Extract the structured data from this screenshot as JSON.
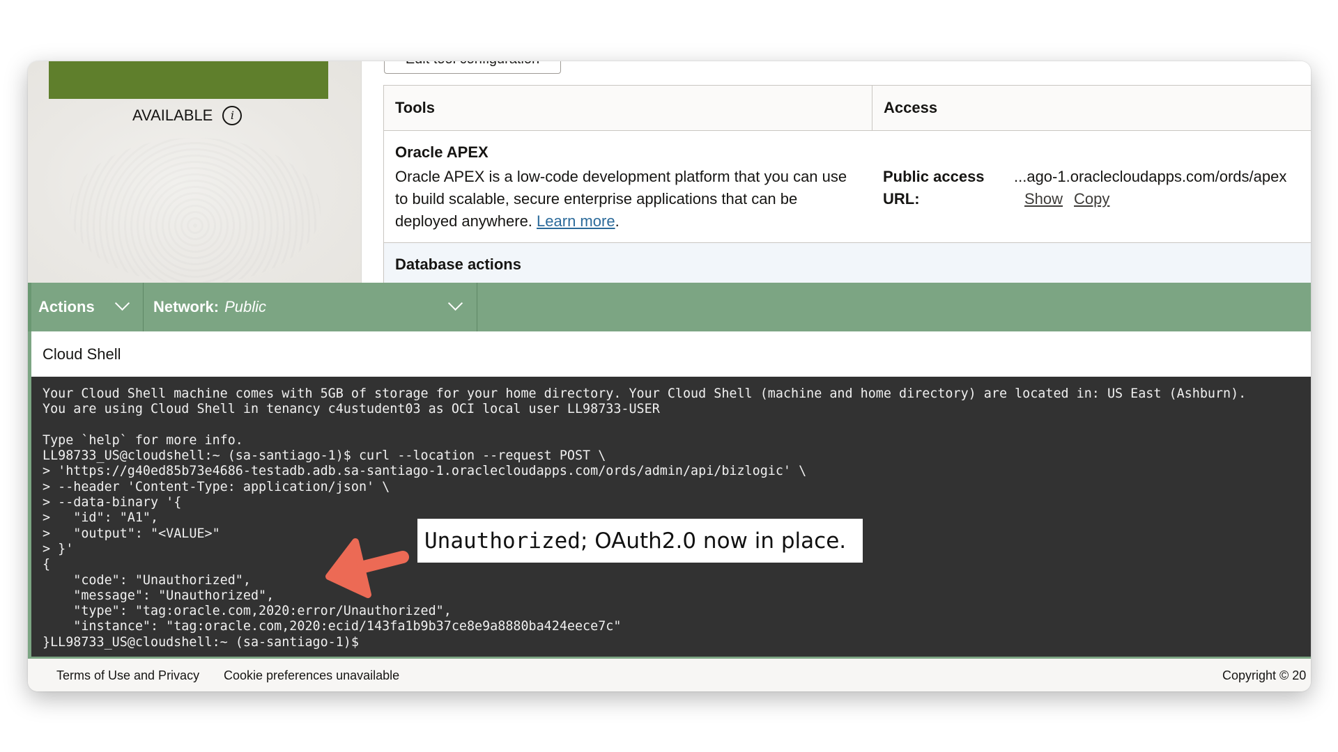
{
  "sidebar": {
    "status_label": "AVAILABLE",
    "info_icon_glyph": "i",
    "status_bar_color": "#5f7f2c"
  },
  "tools_section": {
    "edit_button_label": "Edit tool configuration",
    "columns": [
      "Tools",
      "Access"
    ],
    "apex": {
      "name": "Oracle APEX",
      "description": "Oracle APEX is a low-code development platform that you can use to build scalable, secure enterprise applications that can be deployed anywhere.",
      "learn_more": "Learn more",
      "trailing_period": ".",
      "url_label": "Public access URL:",
      "url_value": "...ago-1.oraclecloudapps.com/ords/apex",
      "show_label": "Show",
      "copy_label": "Copy"
    },
    "next_row_label": "Database actions"
  },
  "toolbar": {
    "actions_label": "Actions",
    "network_label": "Network:",
    "network_value": "Public",
    "color": "#7ca583"
  },
  "cloud_shell": {
    "title": "Cloud Shell",
    "lines": [
      "Your Cloud Shell machine comes with 5GB of storage for your home directory. Your Cloud Shell (machine and home directory) are located in: US East (Ashburn).",
      "You are using Cloud Shell in tenancy c4ustudent03 as OCI local user LL98733-USER",
      "",
      "Type `help` for more info.",
      "LL98733_US@cloudshell:~ (sa-santiago-1)$ curl --location --request POST \\",
      "> 'https://g40ed85b73e4686-testadb.adb.sa-santiago-1.oraclecloudapps.com/ords/admin/api/bizlogic' \\",
      "> --header 'Content-Type: application/json' \\",
      "> --data-binary '{",
      ">   \"id\": \"A1\",",
      ">   \"output\": \"<VALUE>\"",
      "> }'",
      "{",
      "    \"code\": \"Unauthorized\",",
      "    \"message\": \"Unauthorized\",",
      "    \"type\": \"tag:oracle.com,2020:error/Unauthorized\",",
      "    \"instance\": \"tag:oracle.com,2020:ecid/143fa1b9b37ce8e9a8880ba424eece7c\"",
      "}LL98733_US@cloudshell:~ (sa-santiago-1)$"
    ]
  },
  "annotation": {
    "mono_part": "Unauthorized",
    "rest": "; OAuth2.0 now in place.",
    "arrow_color": "#ec6a55"
  },
  "footer": {
    "terms": "Terms of Use and Privacy",
    "cookie": "Cookie preferences unavailable",
    "copyright": "Copyright © 20"
  }
}
